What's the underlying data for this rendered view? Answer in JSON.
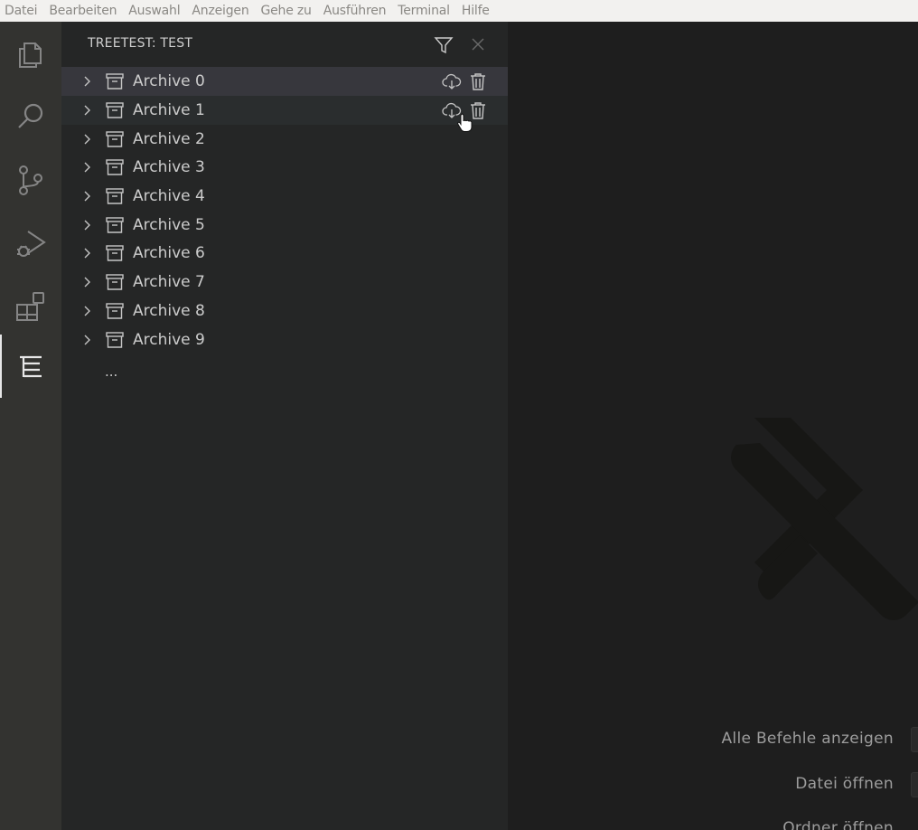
{
  "menubar": {
    "items": [
      "Datei",
      "Bearbeiten",
      "Auswahl",
      "Anzeigen",
      "Gehe zu",
      "Ausführen",
      "Terminal",
      "Hilfe"
    ]
  },
  "activitybar": {
    "icons": [
      "explorer-icon",
      "search-icon",
      "source-control-icon",
      "run-debug-icon",
      "extensions-icon",
      "tree-view-icon"
    ],
    "active": "tree-view-icon"
  },
  "sidebar": {
    "title": "TREETEST: TEST",
    "items": [
      {
        "label": "Archive 0"
      },
      {
        "label": "Archive 1"
      },
      {
        "label": "Archive 2"
      },
      {
        "label": "Archive 3"
      },
      {
        "label": "Archive 4"
      },
      {
        "label": "Archive 5"
      },
      {
        "label": "Archive 6"
      },
      {
        "label": "Archive 7"
      },
      {
        "label": "Archive 8"
      },
      {
        "label": "Archive 9"
      }
    ],
    "more": "..."
  },
  "editor": {
    "hints": [
      "Alle Befehle anzeigen",
      "Datei öffnen",
      "Ordner öffnen"
    ]
  },
  "colors": {
    "activitybar": "#333330",
    "sidebar": "#252626",
    "editor": "#1e1e1e",
    "menubar": "#f2f1ef"
  }
}
